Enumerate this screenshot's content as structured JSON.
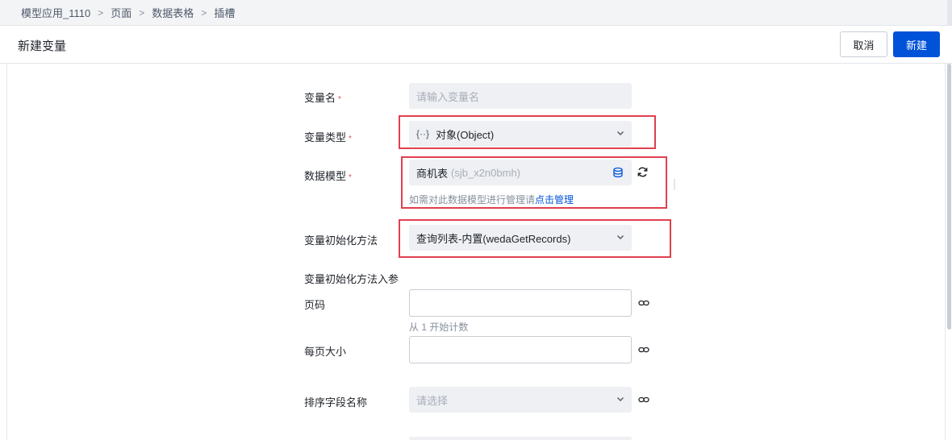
{
  "breadcrumb": {
    "items": [
      "模型应用_1110",
      "页面",
      "数据表格",
      "插槽"
    ],
    "separator": ">"
  },
  "header": {
    "title": "新建变量",
    "cancel_label": "取消",
    "create_label": "新建"
  },
  "form": {
    "var_name": {
      "label": "变量名",
      "required_mark": "*",
      "placeholder": "请输入变量名"
    },
    "var_type": {
      "label": "变量类型",
      "required_mark": "*",
      "type_icon_text": "{··}",
      "value": "对象(Object)"
    },
    "data_model": {
      "label": "数据模型",
      "required_mark": "*",
      "value": "商机表",
      "suffix": "(sjb_x2n0bmh)",
      "hint_prefix": "如需对此数据模型进行管理请",
      "hint_link": "点击管理"
    },
    "init_method": {
      "label": "变量初始化方法",
      "value": "查询列表-内置(wedaGetRecords)"
    },
    "init_params_title": "变量初始化方法入参",
    "page_no": {
      "label": "页码",
      "hint": "从 1 开始计数"
    },
    "page_size": {
      "label": "每页大小"
    },
    "sort_field": {
      "label": "排序字段名称",
      "placeholder": "请选择"
    }
  },
  "colors": {
    "accent": "#0052d9",
    "highlight_box": "#e0404f",
    "required": "#e34d59"
  },
  "icons": [
    "chevron-down-icon",
    "database-icon",
    "refresh-icon",
    "link-icon"
  ]
}
